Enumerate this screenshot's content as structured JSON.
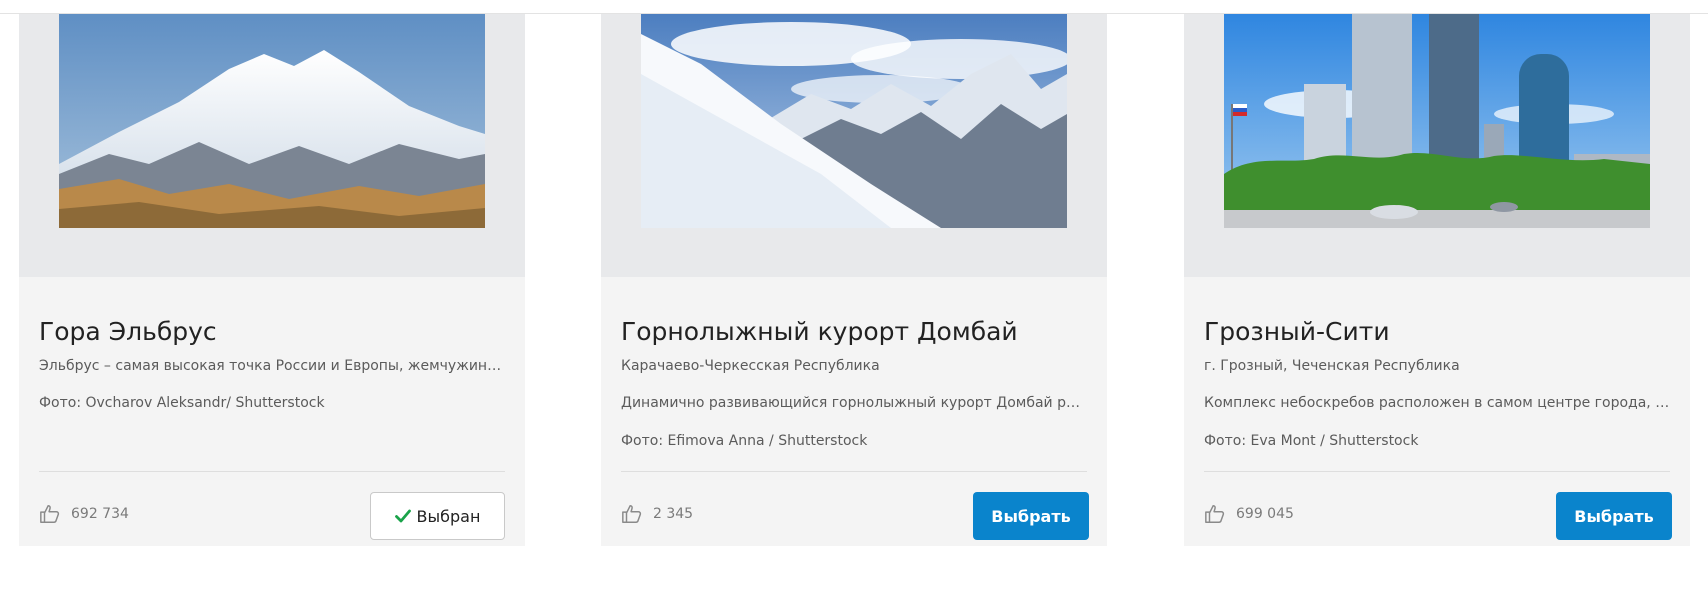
{
  "cards": [
    {
      "title": "Гора Эльбрус",
      "subtitle": "Эльбрус – самая высокая точка России и Европы, жемчужина Центрального Кавказа",
      "credit": "Фото: Ovcharov Aleksandr/ Shutterstock",
      "likes": "692 734",
      "button_label": "Выбран",
      "button_icon": "check-icon",
      "selected": true
    },
    {
      "title": "Горнолыжный курорт Домбай",
      "subtitle": "Карачаево-Черкесская Республика",
      "description": "Динамично развивающийся горнолыжный курорт Домбай расположен в Тебердинском заповеднике",
      "credit": "Фото: Efimova Anna / Shutterstock",
      "likes": "2 345",
      "button_label": "Выбрать",
      "selected": false
    },
    {
      "title": "Грозный-Сити",
      "subtitle": "г. Грозный, Чеченская Республика",
      "description": "Комплекс небоскребов расположен в самом центре города, на берегу реки Сунжа",
      "credit": "Фото: Eva Mont / Shutterstock",
      "likes": "699 045",
      "button_label": "Выбрать",
      "selected": false
    }
  ],
  "colors": {
    "accent": "#0a84cc",
    "check": "#1aa34a",
    "card_bg": "#f4f4f4",
    "media_bg": "#e8e9eb"
  }
}
